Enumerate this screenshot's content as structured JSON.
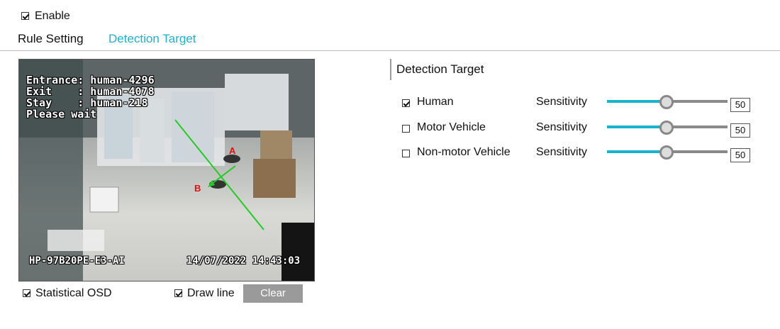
{
  "enable": {
    "label": "Enable",
    "checked": true
  },
  "tabs": [
    {
      "label": "Rule Setting",
      "active": false
    },
    {
      "label": "Detection Target",
      "active": true
    }
  ],
  "video": {
    "osd_lines": "Entrance: human-4296\nExit    : human-4078\nStay    : human-218\nPlease wait",
    "camera_name": "HP-97B20PE-E3-AI",
    "timestamp": "14/07/2022 14:43:03",
    "line_point_a": "A",
    "line_point_b": "B"
  },
  "statistical_osd": {
    "label": "Statistical OSD",
    "checked": true
  },
  "draw_line": {
    "label": "Draw line",
    "checked": true
  },
  "clear_button": "Clear",
  "panel": {
    "title": "Detection Target",
    "targets": [
      {
        "name": "Human",
        "checked": true,
        "sensitivity_label": "Sensitivity",
        "value": "50"
      },
      {
        "name": "Motor Vehicle",
        "checked": false,
        "sensitivity_label": "Sensitivity",
        "value": "50"
      },
      {
        "name": "Non-motor Vehicle",
        "checked": false,
        "sensitivity_label": "Sensitivity",
        "value": "50"
      }
    ]
  },
  "colors": {
    "accent": "#1ab3cf",
    "line": "#22cc22",
    "marker": "#e01010"
  }
}
